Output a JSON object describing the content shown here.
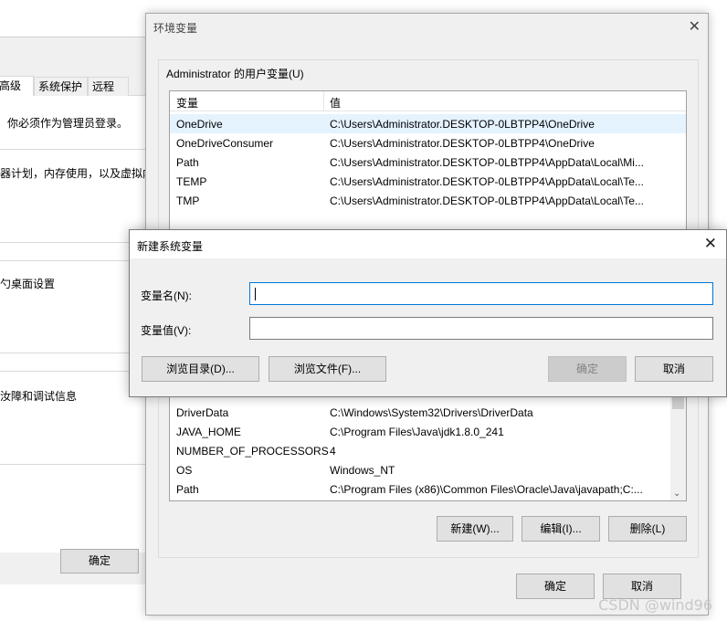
{
  "system_properties": {
    "tabs": [
      "高级",
      "系统保护",
      "远程"
    ],
    "admin_note": "你必须作为管理员登录。",
    "performance_text": "器计划，内存使用，以及虚拟内",
    "profile_text": "勺桌面设置",
    "startup_text": "汝障和调试信息",
    "ok_label": "确定"
  },
  "env_window": {
    "title": "环境变量",
    "close_icon": "close-icon",
    "user_group_label": "Administrator 的用户变量(U)",
    "columns": [
      "变量",
      "值"
    ],
    "user_vars": [
      {
        "name": "OneDrive",
        "value": "C:\\Users\\Administrator.DESKTOP-0LBTPP4\\OneDrive"
      },
      {
        "name": "OneDriveConsumer",
        "value": "C:\\Users\\Administrator.DESKTOP-0LBTPP4\\OneDrive"
      },
      {
        "name": "Path",
        "value": "C:\\Users\\Administrator.DESKTOP-0LBTPP4\\AppData\\Local\\Mi..."
      },
      {
        "name": "TEMP",
        "value": "C:\\Users\\Administrator.DESKTOP-0LBTPP4\\AppData\\Local\\Te..."
      },
      {
        "name": "TMP",
        "value": "C:\\Users\\Administrator.DESKTOP-0LBTPP4\\AppData\\Local\\Te..."
      }
    ],
    "system_vars": [
      {
        "name": "DriverData",
        "value": "C:\\Windows\\System32\\Drivers\\DriverData"
      },
      {
        "name": "JAVA_HOME",
        "value": "C:\\Program Files\\Java\\jdk1.8.0_241"
      },
      {
        "name": "NUMBER_OF_PROCESSORS",
        "value": "4"
      },
      {
        "name": "OS",
        "value": "Windows_NT"
      },
      {
        "name": "Path",
        "value": "C:\\Program Files (x86)\\Common Files\\Oracle\\Java\\javapath;C:..."
      }
    ],
    "new_label": "新建(W)...",
    "edit_label": "编辑(I)...",
    "delete_label": "删除(L)",
    "ok_label": "确定",
    "cancel_label": "取消"
  },
  "new_var_dialog": {
    "title": "新建系统变量",
    "name_label": "变量名(N):",
    "value_label": "变量值(V):",
    "name_value": "",
    "value_value": "",
    "browse_dir_label": "浏览目录(D)...",
    "browse_file_label": "浏览文件(F)...",
    "ok_label": "确定",
    "cancel_label": "取消"
  },
  "watermark": "CSDN @wind96"
}
